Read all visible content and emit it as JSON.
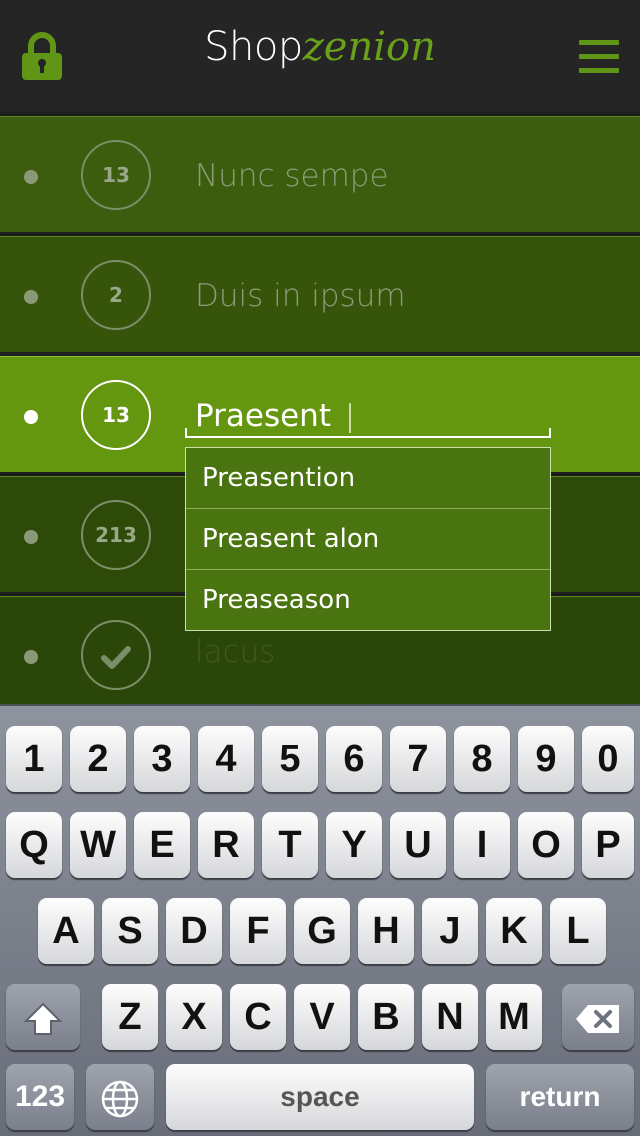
{
  "header": {
    "logo_shop": "Shop",
    "logo_zen": "zenion"
  },
  "rows": [
    {
      "badge": "13",
      "title": "Nunc sempe"
    },
    {
      "badge": "2",
      "title": "Duis in ipsum"
    },
    {
      "badge": "13",
      "title": "Praesent"
    },
    {
      "badge": "213",
      "title": ""
    },
    {
      "badge": "",
      "title": "lacus"
    }
  ],
  "suggestions": [
    "Preasention",
    "Preasent alon",
    "Preaseason"
  ],
  "keyboard": {
    "row_numbers": [
      "1",
      "2",
      "3",
      "4",
      "5",
      "6",
      "7",
      "8",
      "9",
      "0"
    ],
    "row_q": [
      "Q",
      "W",
      "E",
      "R",
      "T",
      "Y",
      "U",
      "I",
      "O",
      "P"
    ],
    "row_a": [
      "A",
      "S",
      "D",
      "F",
      "G",
      "H",
      "J",
      "K",
      "L"
    ],
    "row_z": [
      "Z",
      "X",
      "C",
      "V",
      "B",
      "N",
      "M"
    ],
    "num_label": "123",
    "space_label": "space",
    "return_label": "return"
  },
  "colors": {
    "accent": "#64960f",
    "header": "#252525"
  }
}
